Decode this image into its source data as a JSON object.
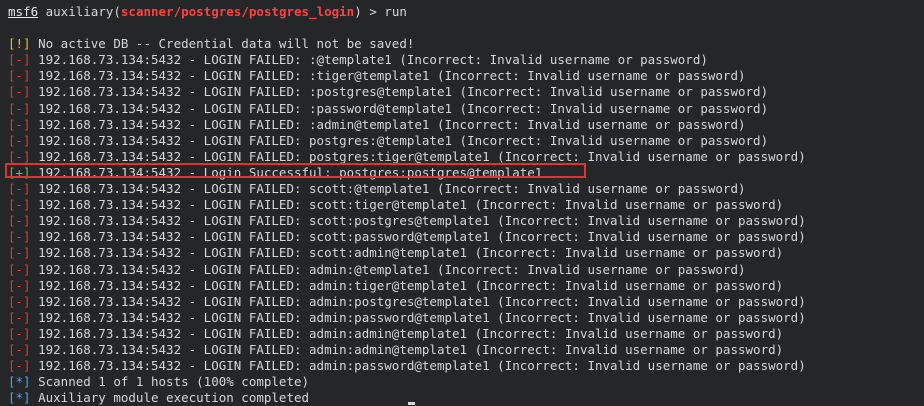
{
  "prompt": {
    "user": "msf6",
    "command_prefix": " auxiliary(",
    "module_path": "scanner/postgres/postgres_login",
    "command_suffix": ") > run"
  },
  "tags": {
    "warn": "[!]",
    "fail": "[-]",
    "good": "[+]",
    "info": "[*]"
  },
  "messages": {
    "no_db": " No active DB -- Credential data will not be saved!",
    "f1": " 192.168.73.134:5432 - LOGIN FAILED: :@template1 (Incorrect: Invalid username or password)",
    "f2": " 192.168.73.134:5432 - LOGIN FAILED: :tiger@template1 (Incorrect: Invalid username or password)",
    "f3": " 192.168.73.134:5432 - LOGIN FAILED: :postgres@template1 (Incorrect: Invalid username or password)",
    "f4": " 192.168.73.134:5432 - LOGIN FAILED: :password@template1 (Incorrect: Invalid username or password)",
    "f5": " 192.168.73.134:5432 - LOGIN FAILED: :admin@template1 (Incorrect: Invalid username or password)",
    "f6": " 192.168.73.134:5432 - LOGIN FAILED: postgres:@template1 (Incorrect: Invalid username or password)",
    "f7": " 192.168.73.134:5432 - LOGIN FAILED: postgres:tiger@template1 (Incorrect: Invalid username or password)",
    "success": " 192.168.73.134:5432 - Login Successful: postgres:postgres@template1",
    "f8": " 192.168.73.134:5432 - LOGIN FAILED: scott:@template1 (Incorrect: Invalid username or password)",
    "f9": " 192.168.73.134:5432 - LOGIN FAILED: scott:tiger@template1 (Incorrect: Invalid username or password)",
    "f10": " 192.168.73.134:5432 - LOGIN FAILED: scott:postgres@template1 (Incorrect: Invalid username or password)",
    "f11": " 192.168.73.134:5432 - LOGIN FAILED: scott:password@template1 (Incorrect: Invalid username or password)",
    "f12": " 192.168.73.134:5432 - LOGIN FAILED: scott:admin@template1 (Incorrect: Invalid username or password)",
    "f13": " 192.168.73.134:5432 - LOGIN FAILED: admin:@template1 (Incorrect: Invalid username or password)",
    "f14": " 192.168.73.134:5432 - LOGIN FAILED: admin:tiger@template1 (Incorrect: Invalid username or password)",
    "f15": " 192.168.73.134:5432 - LOGIN FAILED: admin:postgres@template1 (Incorrect: Invalid username or password)",
    "f16": " 192.168.73.134:5432 - LOGIN FAILED: admin:password@template1 (Incorrect: Invalid username or password)",
    "f17": " 192.168.73.134:5432 - LOGIN FAILED: admin:admin@template1 (Incorrect: Invalid username or password)",
    "f18": " 192.168.73.134:5432 - LOGIN FAILED: admin:admin@template1 (Incorrect: Invalid username or password)",
    "f19": " 192.168.73.134:5432 - LOGIN FAILED: admin:password@template1 (Incorrect: Invalid username or password)",
    "scanned": " Scanned 1 of 1 hosts (100% complete)",
    "completed": " Auxiliary module execution completed"
  },
  "colors": {
    "background": "#242628",
    "module": "#ff4040",
    "warn": "#f0c020",
    "fail": "#e03a3a",
    "good": "#3cd070",
    "info": "#4aa3ff",
    "highlight_box": "#e53030"
  }
}
